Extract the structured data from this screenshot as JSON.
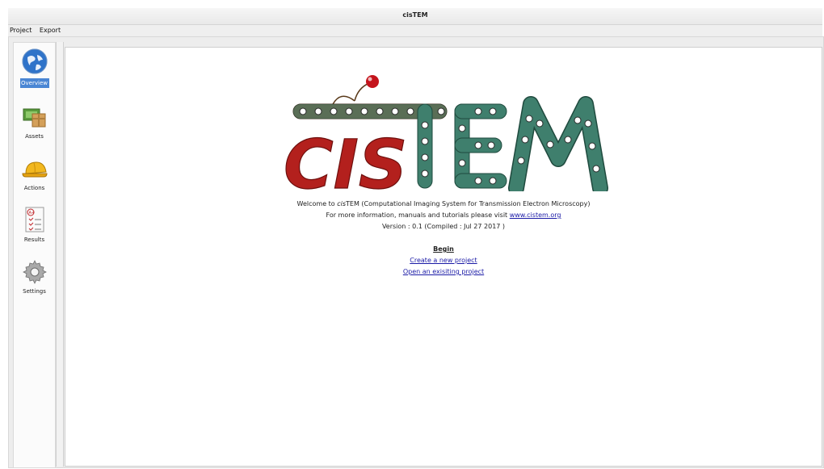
{
  "window": {
    "title": "cisTEM"
  },
  "menu": {
    "items": [
      "Project",
      "Export"
    ]
  },
  "sidebar": {
    "items": [
      {
        "label": "Overview",
        "icon": "globe-icon",
        "selected": true
      },
      {
        "label": "Assets",
        "icon": "boxes-icon",
        "selected": false
      },
      {
        "label": "Actions",
        "icon": "hardhat-icon",
        "selected": false
      },
      {
        "label": "Results",
        "icon": "checklist-icon",
        "selected": false
      },
      {
        "label": "Settings",
        "icon": "gear-icon",
        "selected": false
      }
    ]
  },
  "logo": {
    "text": "cisTEM",
    "cis": "CIS",
    "tem": "TEM"
  },
  "welcome": {
    "line1_prefix": "Welcome to ",
    "line1_app": "cis",
    "line1_app_rest": "TEM",
    "line1_suffix": " (Computational Imaging System for Transmission Electron Microscopy)",
    "line2_prefix": "For more information, manuals and tutorials please visit ",
    "line2_link": "www.cistem.org",
    "line3": "Version : 0.1 (Compiled : Jul 27 2017 )"
  },
  "begin": {
    "heading": "Begin",
    "create": "Create a new project",
    "open": "Open an exisiting project"
  },
  "colors": {
    "accent": "#4a86d4",
    "logo_red": "#b3201d",
    "logo_teal": "#3f7f6d",
    "link": "#1a1aa6"
  }
}
